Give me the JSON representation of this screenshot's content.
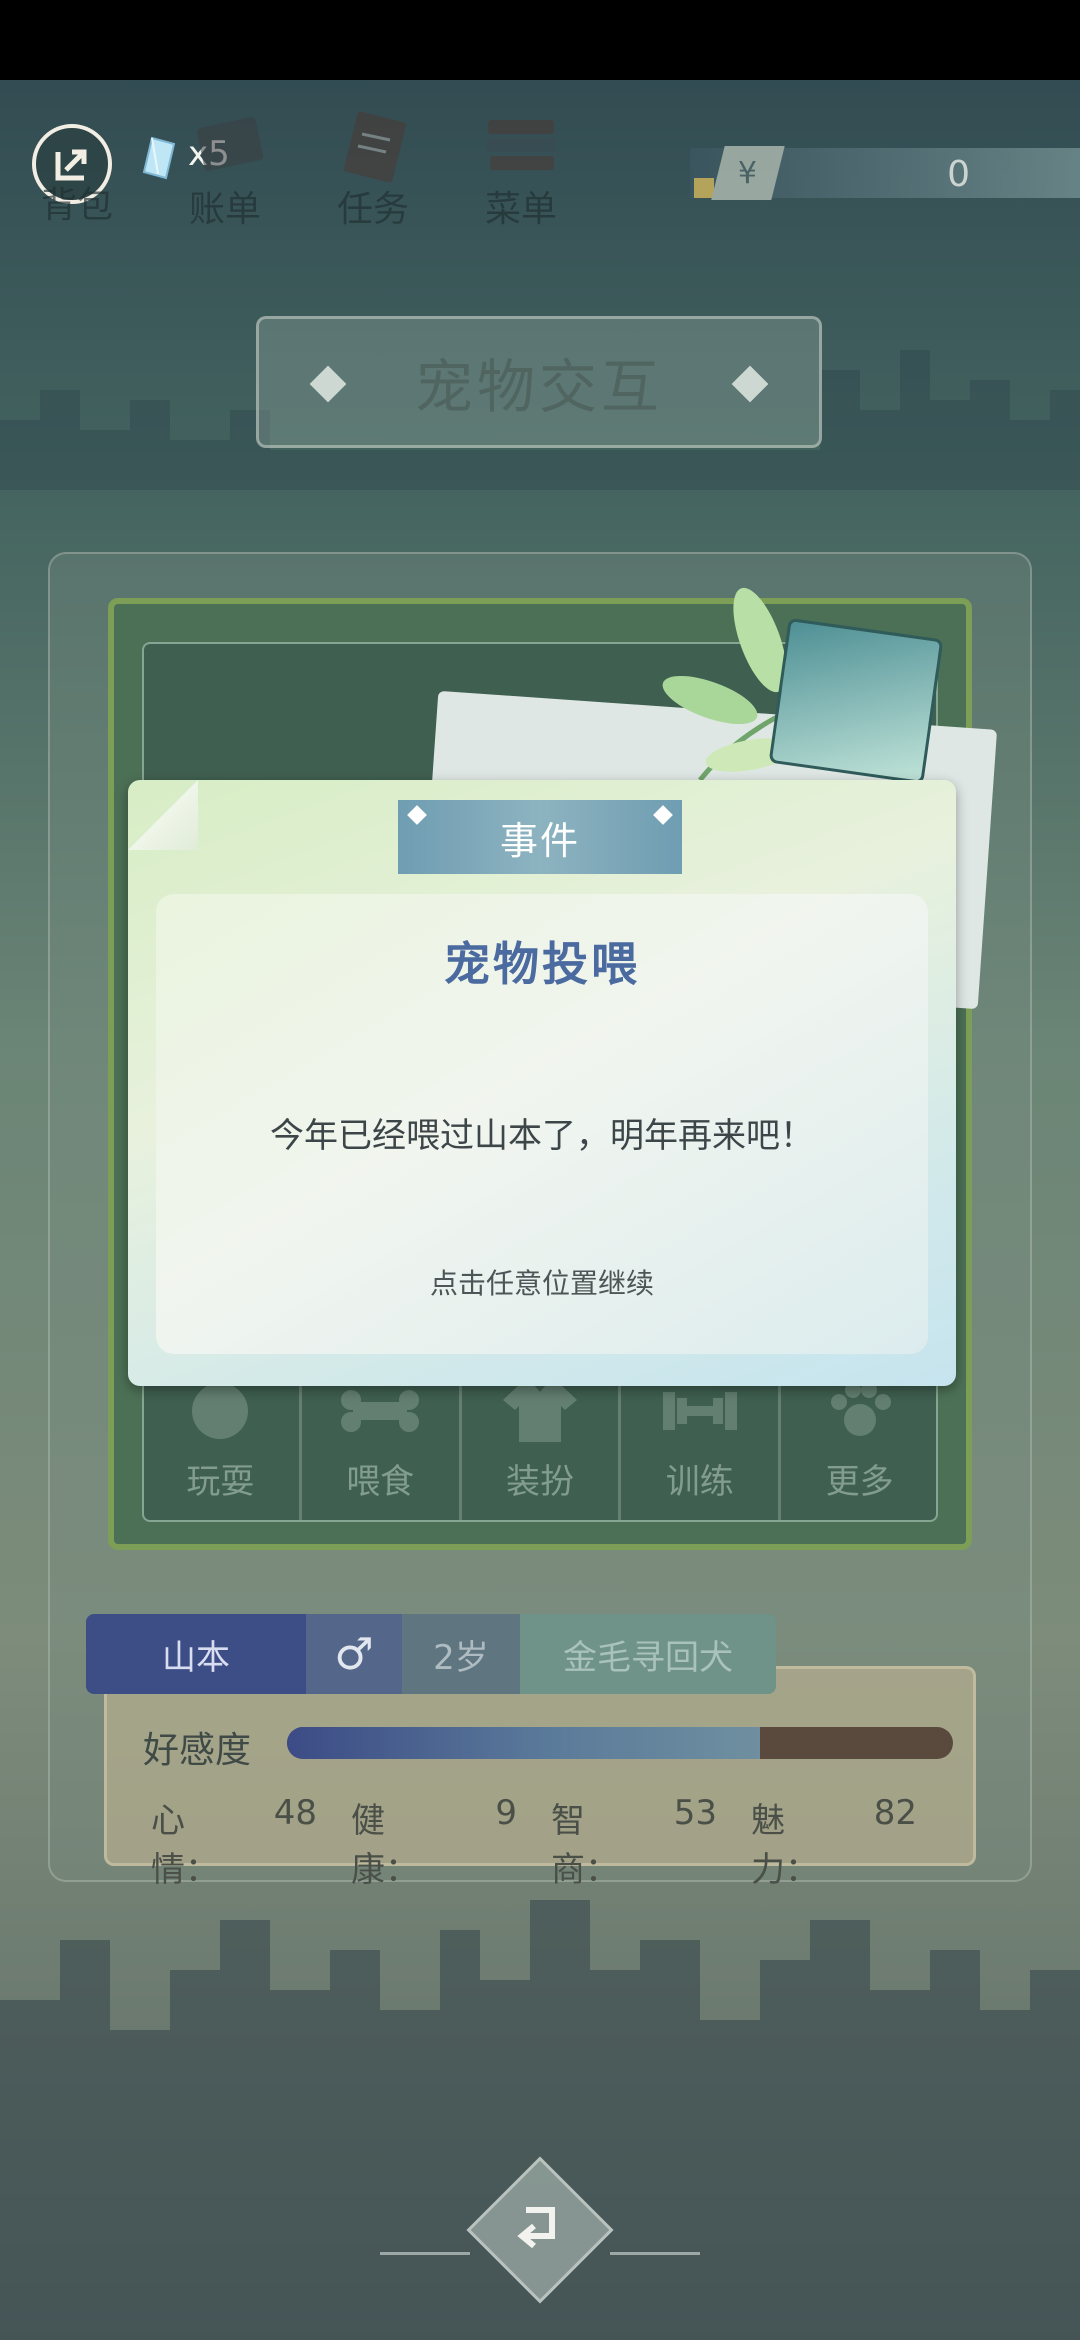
{
  "topbar": {
    "gem_count": "x5",
    "nav": [
      {
        "label": "背包",
        "icon": "bag-icon"
      },
      {
        "label": "账单",
        "icon": "bill-icon"
      },
      {
        "label": "任务",
        "icon": "task-icon"
      },
      {
        "label": "菜单",
        "icon": "menu-icon"
      }
    ],
    "money_symbol": "¥",
    "money": "0"
  },
  "page_title": "宠物交互",
  "actions": [
    {
      "label": "玩耍",
      "icon": "ball-icon"
    },
    {
      "label": "喂食",
      "icon": "bone-icon"
    },
    {
      "label": "装扮",
      "icon": "shirt-icon"
    },
    {
      "label": "训练",
      "icon": "dumbbell-icon"
    },
    {
      "label": "更多",
      "icon": "paw-icon"
    }
  ],
  "pet": {
    "name": "山本",
    "gender_symbol": "♂",
    "age": "2岁",
    "breed": "金毛寻回犬",
    "favor_label": "好感度",
    "favor_level": 0.71,
    "stats": [
      {
        "label": "心情：",
        "value": "48"
      },
      {
        "label": "健康：",
        "value": "9"
      },
      {
        "label": "智商：",
        "value": "53"
      },
      {
        "label": "魅力：",
        "value": "82"
      }
    ]
  },
  "modal": {
    "header": "事件",
    "title": "宠物投喂",
    "message": "今年已经喂过山本了，明年再来吧！",
    "hint": "点击任意位置继续"
  },
  "colors": {
    "accent_blue": "#3d4e86",
    "modal_title": "#4a6aa0",
    "header_bar": "#6f9db2"
  }
}
